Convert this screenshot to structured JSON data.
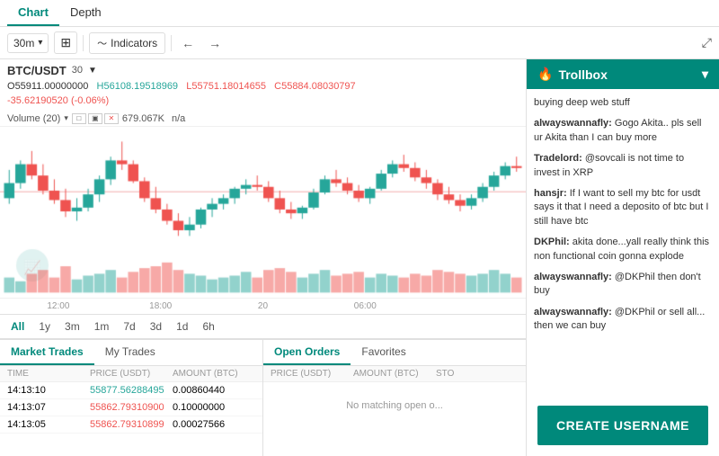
{
  "tabs": [
    {
      "label": "Chart",
      "active": true
    },
    {
      "label": "Depth",
      "active": false
    }
  ],
  "toolbar": {
    "timeframe": "30m",
    "indicators_label": "Indicators",
    "undo_label": "←",
    "redo_label": "→",
    "expand_label": "⤢"
  },
  "chart": {
    "pair": "BTC/USDT",
    "interval": "30",
    "arrow": "▼",
    "ohlc": {
      "o_label": "O",
      "o_val": "55911.00000000",
      "h_label": "H",
      "h_val": "56108.19518969",
      "l_label": "L",
      "l_val": "55751.18014655",
      "c_label": "C",
      "c_val": "55884.08030797"
    },
    "change": "-35.62190520 (-0.06%)",
    "volume_label": "Volume (20)",
    "volume_val": "679.067K",
    "volume_na": "n/a",
    "time_labels": [
      "12:00",
      "18:00",
      "20",
      "06:00",
      ""
    ]
  },
  "periods": [
    {
      "label": "All",
      "active": true
    },
    {
      "label": "1y",
      "active": false
    },
    {
      "label": "3m",
      "active": false
    },
    {
      "label": "1m",
      "active": false
    },
    {
      "label": "7d",
      "active": false
    },
    {
      "label": "3d",
      "active": false
    },
    {
      "label": "1d",
      "active": false
    },
    {
      "label": "6h",
      "active": false
    }
  ],
  "market_trades": {
    "tab_label": "Market Trades",
    "my_trades_label": "My Trades",
    "headers": [
      "TIME",
      "PRICE (USDT)",
      "AMOUNT (BTC)"
    ],
    "rows": [
      {
        "time": "14:13:10",
        "price": "55877.56288495",
        "amount": "0.00860440",
        "type": "green"
      },
      {
        "time": "14:13:07",
        "price": "55862.79310900",
        "amount": "0.10000000",
        "type": "red"
      },
      {
        "time": "14:13:05",
        "price": "55862.79310899",
        "amount": "0.00027566",
        "type": "red"
      }
    ]
  },
  "open_orders": {
    "tab_label": "Open Orders",
    "favorites_label": "Favorites",
    "headers": [
      "PRICE (USDT)",
      "AMOUNT (BTC)",
      "STO"
    ],
    "no_orders_msg": "No matching open o..."
  },
  "trollbox": {
    "title": "Trollbox",
    "messages": [
      {
        "text": "buying deep web stuff"
      },
      {
        "sender": "alwayswannafly:",
        "text": "Gogo Akita.. pls sell ur Akita than I can buy more"
      },
      {
        "sender": "Tradelord:",
        "text": "@sovcali is not time to invest in XRP"
      },
      {
        "sender": "hansjr:",
        "text": "If I want to sell my btc for usdt says it that I need a deposito of btc but I still have btc"
      },
      {
        "sender": "DKPhil:",
        "text": "akita done...yall really think this non functional coin gonna explode"
      },
      {
        "sender": "alwayswannafly:",
        "text": "@DKPhil then don't buy"
      },
      {
        "sender": "alwayswannafly:",
        "text": "@DKPhil or sell all... then we can buy"
      }
    ],
    "create_username": "CREATE USERNAME"
  }
}
